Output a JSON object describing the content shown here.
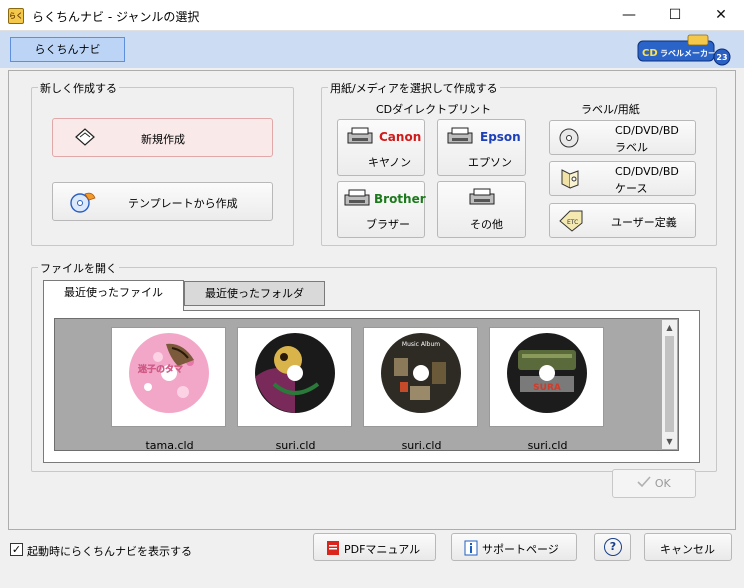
{
  "window": {
    "icon_text": "らく",
    "title": "らくちんナビ - ジャンルの選択",
    "minimize": "—",
    "maximize": "☐",
    "close": "✕"
  },
  "top_tab": {
    "label": "らくちんナビ"
  },
  "new_group": {
    "label": "新しく作成する",
    "buttons": [
      {
        "label": "新規作成",
        "icon": "diamond-outline-icon"
      },
      {
        "label": "テンプレートから作成",
        "icon": "cd-template-icon"
      }
    ]
  },
  "media_group": {
    "label": "用紙/メディアを選択して作成する",
    "cd_direct_heading": "CDダイレクトプリント",
    "printers": [
      {
        "brand": "Canon",
        "name": "キヤノン",
        "brand_color": "#d11a1a"
      },
      {
        "brand": "Epson",
        "name": "エプソン",
        "brand_color": "#1d3fb8"
      },
      {
        "brand": "Brother",
        "name": "ブラザー",
        "brand_color": "#1c7a1c"
      },
      {
        "brand": "",
        "name": "その他",
        "brand_color": "#000000"
      }
    ],
    "label_heading": "ラベル/用紙",
    "label_buttons": [
      {
        "line1": "CD/DVD/BD",
        "line2": "ラベル",
        "icon": "cd-disc-icon"
      },
      {
        "line1": "CD/DVD/BD",
        "line2": "ケース",
        "icon": "cd-case-icon"
      },
      {
        "line1": "ユーザー定義",
        "line2": "",
        "icon": "etc-tag-icon"
      }
    ]
  },
  "open_group": {
    "label": "ファイルを開く",
    "tabs": [
      {
        "label": "最近使ったファイル",
        "active": true
      },
      {
        "label": "最近使ったフォルダ",
        "active": false
      }
    ],
    "files": [
      {
        "name": "tama.cld",
        "disc_text": "迷子のタマ"
      },
      {
        "name": "suri.cld",
        "disc_text": ""
      },
      {
        "name": "suri.cld",
        "disc_text": "Music Album"
      },
      {
        "name": "suri.cld",
        "disc_text": "SURA"
      }
    ],
    "ok_label": "OK"
  },
  "footer": {
    "startup_checkbox": {
      "checked": true,
      "mark": "✓",
      "label": "起動時にらくちんナビを表示する"
    },
    "pdf_manual": "PDFマニュアル",
    "support_page": "サポートページ",
    "help": "?",
    "cancel": "キャンセル"
  },
  "logo": {
    "text": "CDラベルメーカー",
    "badge": "23"
  }
}
